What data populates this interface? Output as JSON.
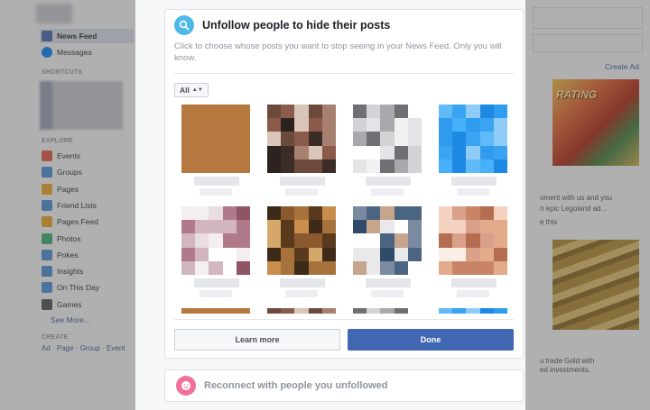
{
  "sidebar": {
    "news_feed": "News Feed",
    "messages": "Messages",
    "shortcuts_heading": "SHORTCUTS",
    "explore_heading": "EXPLORE",
    "explore_items": [
      "Events",
      "Groups",
      "Pages",
      "Friend Lists",
      "Pages Feed",
      "Photos",
      "Pokes",
      "Insights",
      "On This Day",
      "Games"
    ],
    "see_more": "See More...",
    "create_heading": "CREATE",
    "create_links": "Ad · Page · Group · Event"
  },
  "right_column": {
    "create_ad": "Create Ad",
    "ad1_title": "RATING",
    "ad1_text_1": "oment with us and you",
    "ad1_text_2": "n epic Legoland ad...",
    "ad1_text_3": "e this",
    "ad2_text_1": "u trade Gold with",
    "ad2_text_2": "ed investments."
  },
  "modal": {
    "title": "Unfollow people to hide their posts",
    "subtitle": "Click to choose whose posts you want to stop seeing in your News Feed. Only you will know.",
    "filter_value": "All",
    "learn_more": "Learn more",
    "done": "Done",
    "reconnect": "Reconnect with people you unfollowed"
  },
  "colors": {
    "brand_blue": "#4267b2",
    "search_icon_bg": "#4db8e8",
    "reconnect_icon_bg": "#f0729a",
    "link_blue": "#365899"
  },
  "icons": {
    "search": "search-icon",
    "reconnect": "smiley-icon",
    "filter": "sort-arrows-icon"
  }
}
